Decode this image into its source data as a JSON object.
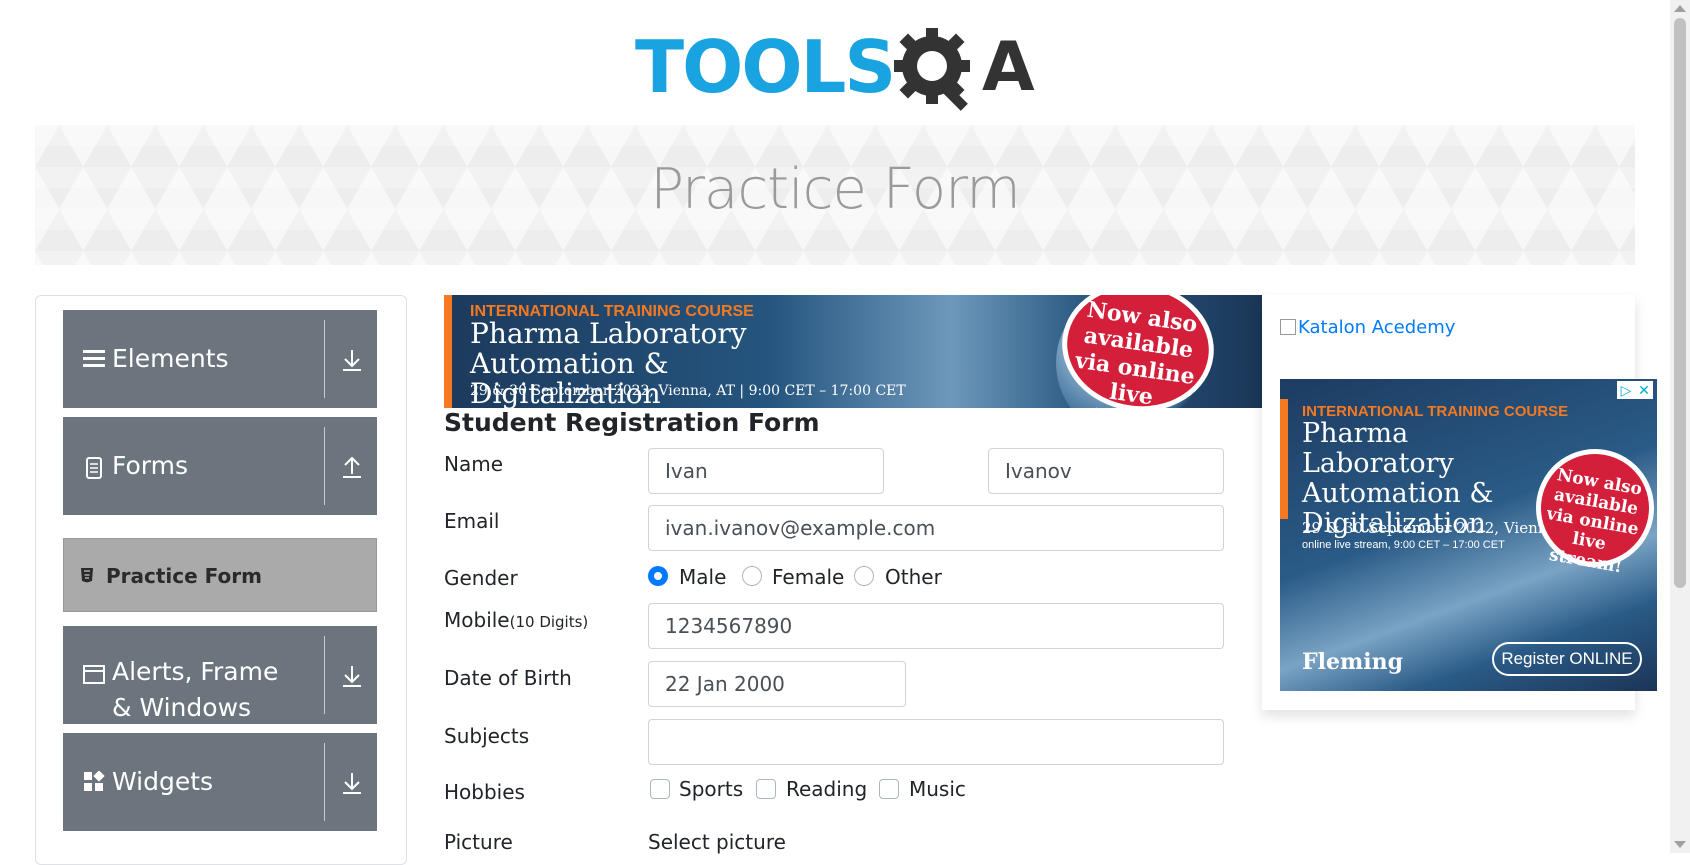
{
  "header": {
    "logo_text": "TOOLS",
    "logo_suffix": "A"
  },
  "banner": {
    "title": "Practice Form"
  },
  "sidebar": {
    "groups": [
      {
        "label": "Elements",
        "icon": "hamburger-icon",
        "expanded": false
      },
      {
        "label": "Forms",
        "icon": "document-icon",
        "expanded": true
      },
      {
        "label": "Alerts, Frame & Windows",
        "icon": "window-icon",
        "expanded": false
      },
      {
        "label": "Widgets",
        "icon": "widgets-icon",
        "expanded": false
      }
    ],
    "active_item": "Practice Form"
  },
  "ad_top": {
    "line1": "INTERNATIONAL TRAINING COURSE",
    "line2": "Pharma Laboratory Automation & Digitalization",
    "line3": "29 & 30 September 2022, Vienna, AT | 9:00 CET – 17:00 CET",
    "badge": "Now also available via online live stream!"
  },
  "form": {
    "title": "Student Registration Form",
    "name_label": "Name",
    "first_name": "Ivan",
    "last_name": "Ivanov",
    "email_label": "Email",
    "email": "ivan.ivanov@example.com",
    "gender_label": "Gender",
    "genders": [
      "Male",
      "Female",
      "Other"
    ],
    "gender_selected": "Male",
    "mobile_label": "Mobile",
    "mobile_hint": "(10 Digits)",
    "mobile": "1234567890",
    "dob_label": "Date of Birth",
    "dob": "22 Jan 2000",
    "subjects_label": "Subjects",
    "subjects": "",
    "hobbies_label": "Hobbies",
    "hobbies": [
      "Sports",
      "Reading",
      "Music"
    ],
    "picture_label": "Picture",
    "picture_value": "Select picture"
  },
  "right_col": {
    "link_text": "Katalon Acedemy",
    "ad": {
      "line1": "INTERNATIONAL TRAINING COURSE",
      "line2": "Pharma Laboratory Automation & Digitalization",
      "line3": "29 & 30 September 2022, Vienna, AT",
      "line4": "online live stream, 9:00 CET – 17:00 CET",
      "badge": "Now also available via online live stream!",
      "brand": "Fleming",
      "cta": "Register ONLINE"
    }
  },
  "colors": {
    "accent": "#007bff",
    "sidebar_header": "#6c757d",
    "sidebar_active": "#aaaaaa",
    "logo_blue": "#1aa3e1"
  }
}
